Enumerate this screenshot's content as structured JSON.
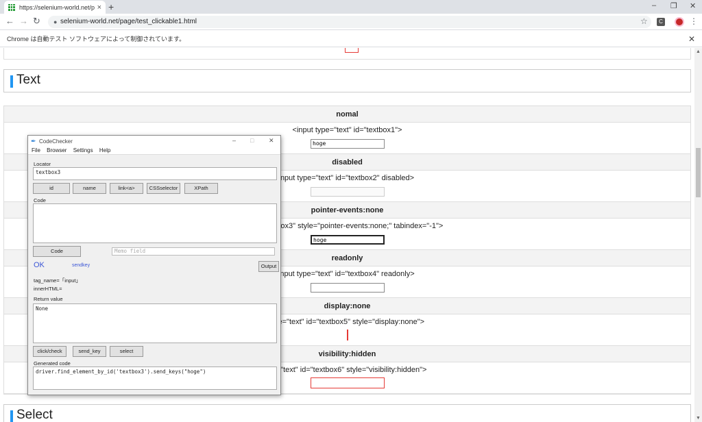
{
  "browser": {
    "tab_title": "https://selenium-world.net/page",
    "tab_close": "×",
    "new_tab": "+",
    "win_min": "‒",
    "win_max": "❐",
    "win_close": "✕",
    "back": "←",
    "forward": "→",
    "reload": "↻",
    "url": "selenium-world.net/page/test_clickable1.html",
    "lock": "🔒",
    "star": "☆",
    "ext": "C",
    "menu": "⋮"
  },
  "infobar": {
    "text": "Chrome は自動テスト ソフトウェアによって制御されています。",
    "close": "✕"
  },
  "page": {
    "section_text": "Text",
    "section_select": "Select",
    "rows": [
      {
        "header": "nomal",
        "code": "<input type=\"text\" id=\"textbox1\">",
        "value": "hoge"
      },
      {
        "header": "disabled",
        "code": "nput type=\"text\" id=\"textbox2\" disabled>",
        "value": ""
      },
      {
        "header": "pointer-events:none",
        "code": "id=\"textbox3\" style=\"pointer-events:none;\" tabindex=\"-1\">",
        "value": "hoge"
      },
      {
        "header": "readonly",
        "code": "nput type=\"text\" id=\"textbox4\" readonly>",
        "value": ""
      },
      {
        "header": "display:none",
        "code": "ype=\"text\" id=\"textbox5\" style=\"display:none\">"
      },
      {
        "header": "visibility:hidden",
        "code": "pe=\"text\" id=\"textbox6\" style=\"visibility:hidden\">"
      }
    ]
  },
  "dialog": {
    "title": "CodeChecker",
    "menu": [
      "File",
      "Browser",
      "Settings",
      "Help"
    ],
    "locator_label": "Locator",
    "locator_value": "textbox3",
    "locator_buttons": [
      "id",
      "name",
      "link<a>",
      "CSSselector",
      "XPath"
    ],
    "code_label": "Code",
    "code_value": "",
    "code_button": "Code",
    "memo_placeholder": "Memo field",
    "ok": "OK",
    "sendkey": "sendkey",
    "output_button": "Output",
    "tag_name": "tag_name=「input」",
    "inner_html": "innerHTML=",
    "return_label": "Return value",
    "return_value": "None",
    "action_buttons": [
      "click/check",
      "send_key",
      "select"
    ],
    "generated_label": "Generated code",
    "generated_value": "driver.find_element_by_id('textbox3').send_keys(\"hoge\")",
    "title_min": "–",
    "title_max": "□",
    "title_close": "✕"
  }
}
